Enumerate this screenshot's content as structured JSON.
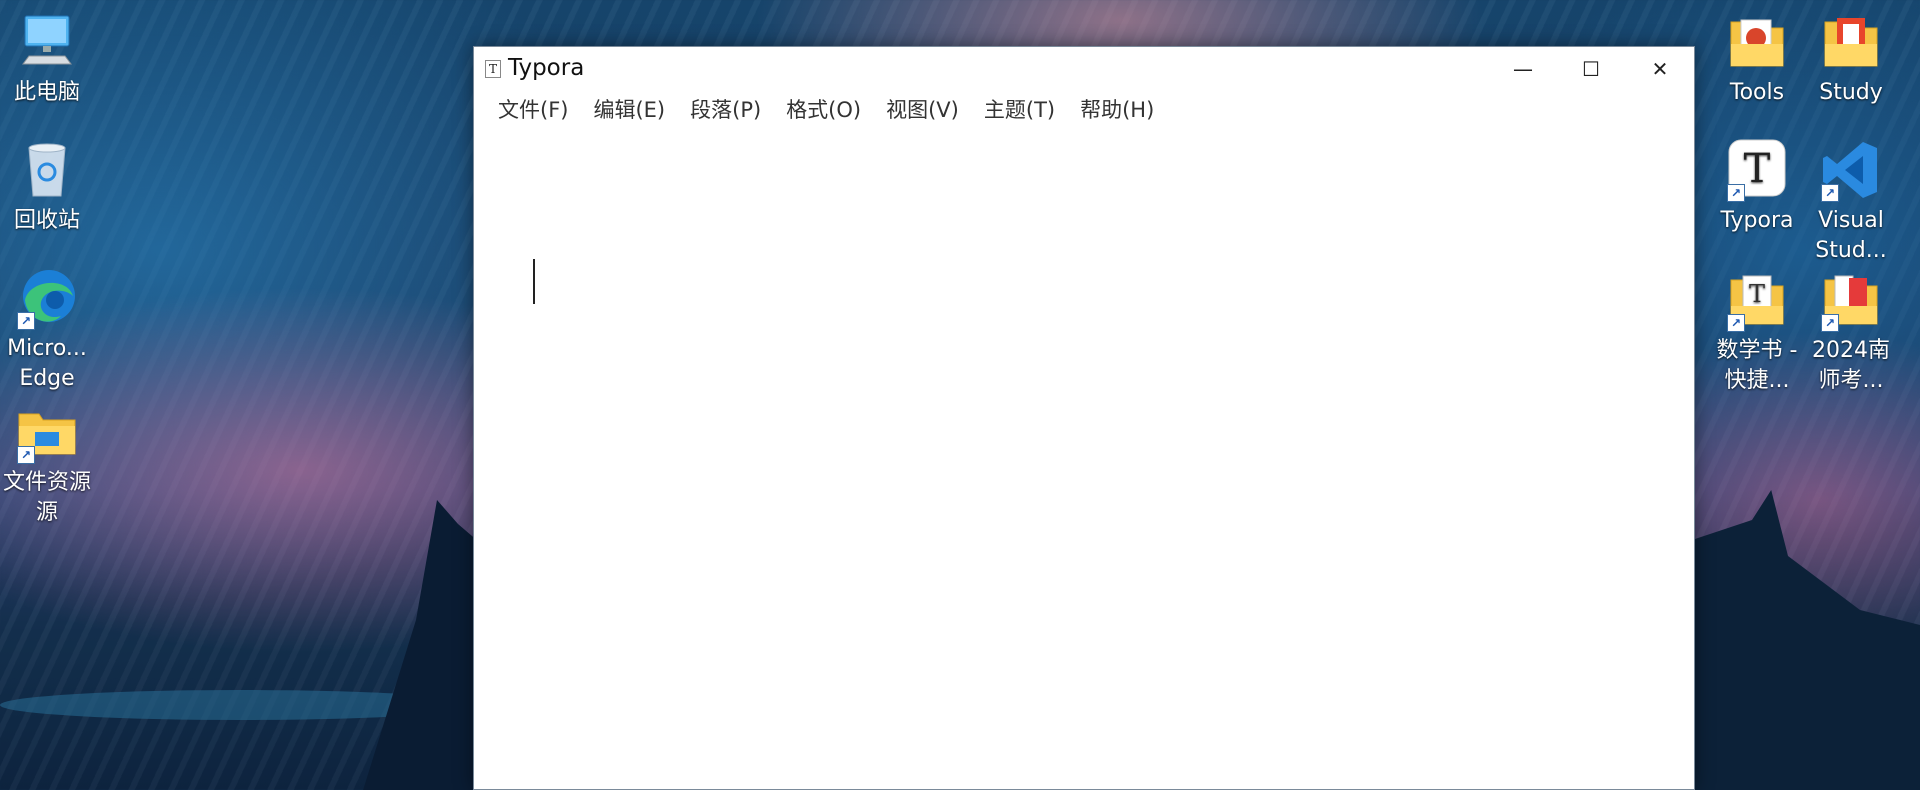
{
  "desktop": {
    "left_icons": [
      {
        "label": "此电脑",
        "icon": "computer-icon"
      },
      {
        "label": "回收站",
        "icon": "recycle-bin-icon"
      },
      {
        "label": "Micro... Edge",
        "icon": "edge-icon"
      },
      {
        "label": "文件资源",
        "label2": "源",
        "icon": "file-explorer-icon"
      }
    ],
    "right_icons": [
      {
        "label": "Tools",
        "icon": "folder-icon"
      },
      {
        "label": "Study",
        "icon": "folder-icon"
      },
      {
        "label": "Typora",
        "icon": "typora-icon"
      },
      {
        "label": "Visual",
        "label2": "Stud...",
        "icon": "vscode-icon"
      },
      {
        "label": "数学书 -",
        "label2": "快捷...",
        "icon": "folder-shortcut-icon"
      },
      {
        "label": "2024南",
        "label2": "师考...",
        "icon": "folder-shortcut-icon"
      }
    ]
  },
  "window": {
    "title": "Typora",
    "app_icon_letter": "T",
    "controls": {
      "minimize": "—",
      "maximize": "☐",
      "close": "✕"
    },
    "menu": [
      "文件(F)",
      "编辑(E)",
      "段落(P)",
      "格式(O)",
      "视图(V)",
      "主题(T)",
      "帮助(H)"
    ]
  },
  "colors": {
    "edge_blue": "#1b7fd6",
    "vscode_blue": "#2a8ae0",
    "folder_yellow": "#f5c445"
  }
}
